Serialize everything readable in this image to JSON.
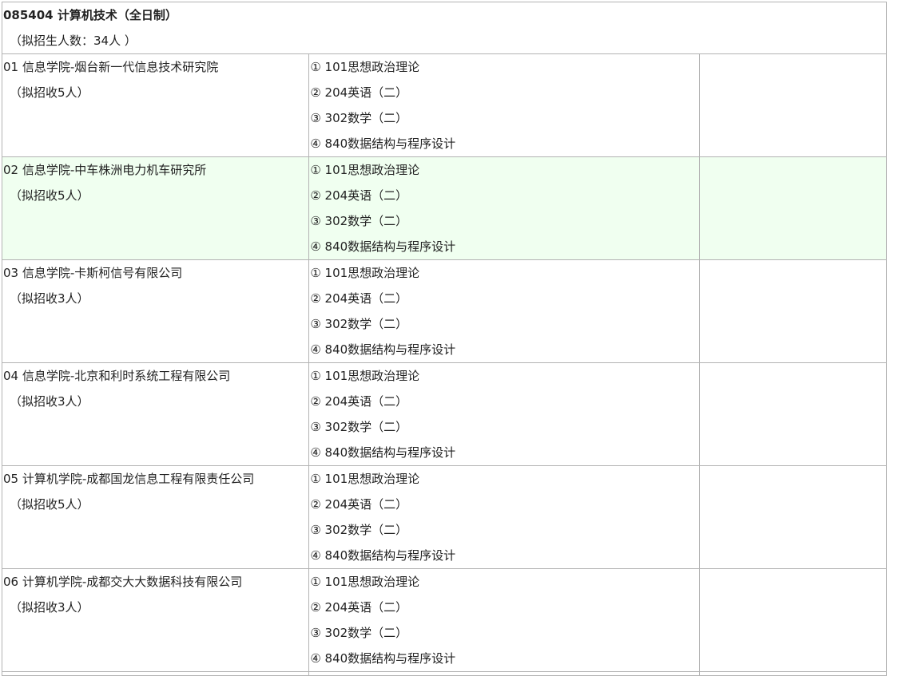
{
  "major": {
    "title": "085404 计算机技术（全日制）",
    "quota": "（拟招生人数：34人 ）"
  },
  "directions": [
    {
      "name": "01 信息学院-烟台新一代信息技术研究院",
      "quota": "（拟招收5人）",
      "exams": [
        "① 101思想政治理论",
        "② 204英语（二）",
        "③ 302数学（二）",
        "④ 840数据结构与程序设计"
      ]
    },
    {
      "name": "02 信息学院-中车株洲电力机车研究所",
      "quota": "（拟招收5人）",
      "exams": [
        "① 101思想政治理论",
        "② 204英语（二）",
        "③ 302数学（二）",
        "④ 840数据结构与程序设计"
      ]
    },
    {
      "name": "03 信息学院-卡斯柯信号有限公司",
      "quota": "（拟招收3人）",
      "exams": [
        "① 101思想政治理论",
        "② 204英语（二）",
        "③ 302数学（二）",
        "④ 840数据结构与程序设计"
      ]
    },
    {
      "name": "04 信息学院-北京和利时系统工程有限公司",
      "quota": "（拟招收3人）",
      "exams": [
        "① 101思想政治理论",
        "② 204英语（二）",
        "③ 302数学（二）",
        "④ 840数据结构与程序设计"
      ]
    },
    {
      "name": "05 计算机学院-成都国龙信息工程有限责任公司",
      "quota": "（拟招收5人）",
      "exams": [
        "① 101思想政治理论",
        "② 204英语（二）",
        "③ 302数学（二）",
        "④ 840数据结构与程序设计"
      ]
    },
    {
      "name": "06 计算机学院-成都交大大数据科技有限公司",
      "quota": "（拟招收3人）",
      "exams": [
        "① 101思想政治理论",
        "② 204英语（二）",
        "③ 302数学（二）",
        "④ 840数据结构与程序设计"
      ]
    }
  ],
  "colors": {
    "highlight_row": "#f0fff0",
    "border": "#b3b3b3"
  }
}
